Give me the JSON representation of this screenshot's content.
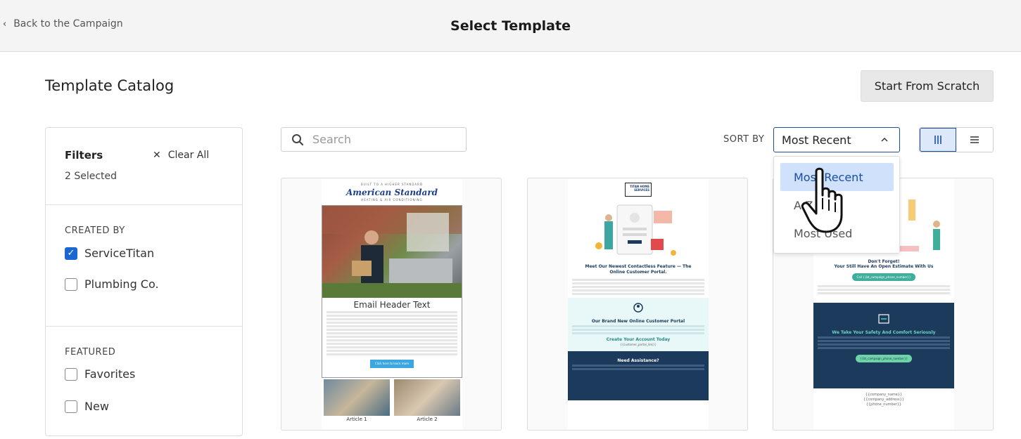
{
  "header": {
    "back_label": "Back to the Campaign",
    "page_title": "Select Template"
  },
  "catalog": {
    "title": "Template Catalog",
    "start_button": "Start From Scratch"
  },
  "filters": {
    "title": "Filters",
    "clear_label": "Clear All",
    "selected_count": "2 Selected",
    "created_by": {
      "title": "CREATED BY",
      "options": [
        {
          "label": "ServiceTitan",
          "checked": true
        },
        {
          "label": "Plumbing Co.",
          "checked": false
        }
      ]
    },
    "featured": {
      "title": "FEATURED",
      "options": [
        {
          "label": "Favorites",
          "checked": false
        },
        {
          "label": "New",
          "checked": false
        }
      ]
    }
  },
  "search": {
    "placeholder": "Search",
    "value": ""
  },
  "sort": {
    "label": "SORT BY",
    "selected": "Most Recent",
    "options": [
      "Most Recent",
      "A-Z",
      "Most Used"
    ]
  },
  "templates": [
    {
      "brand_tagline": "BUILT TO A HIGHER STANDARD",
      "brand": "American Standard",
      "brand_sub": "HEATING & AIR CONDITIONING",
      "header_text": "Email Header Text",
      "cta": "Click here to learn more",
      "articles": [
        "Article 1",
        "Article 2"
      ]
    },
    {
      "logo": "TITAN HOME SERVICES",
      "headline": "Meet Our Newest Contactless Feature — The Online Customer Portal.",
      "section_title": "Our Brand New Online Customer Portal",
      "cta": "Create Your Account Today",
      "cta_sub": "{{customer_portal_link}}",
      "footer_title": "Need Assistance?"
    },
    {
      "headline": "Don't Forget!",
      "headline2": "Your Still Have An Open Estimate With Us",
      "phone_button": "Call {{bt_campaign_phone_number}}",
      "section_title": "We Take Your Safety And Comfort Seriously",
      "phone_button2": "{{bt_campaign_phone_number}}",
      "footer_lines": [
        "{{company_name}}",
        "{{company_address}}",
        "{{phone_number}}"
      ]
    }
  ],
  "colors": {
    "accent": "#1a4ea0",
    "checkbox": "#1a67d2",
    "dropdown_selected": "#cfe1fb",
    "navy": "#1b3a5c",
    "teal": "#3fae9a"
  }
}
